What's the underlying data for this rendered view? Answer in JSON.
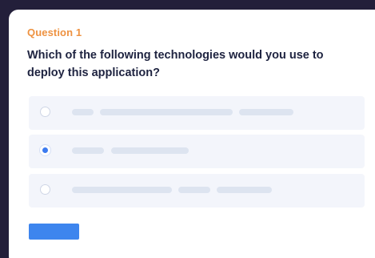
{
  "question": {
    "label": "Question 1",
    "text": "Which of the following technologies would you use to deploy this application?"
  },
  "options": [
    {
      "selected": false
    },
    {
      "selected": true
    },
    {
      "selected": false
    }
  ],
  "colors": {
    "background": "#231f3a",
    "card": "#ffffff",
    "label_accent": "#ee9241",
    "question_text": "#1e2340",
    "option_bg": "#f3f5fb",
    "placeholder_bar": "#dde4f0",
    "radio_selected": "#3c7bf0",
    "button": "#3d85ee"
  }
}
